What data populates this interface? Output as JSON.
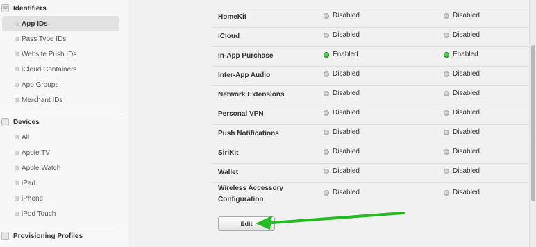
{
  "sidebar": {
    "identifiers": {
      "title": "Identifiers",
      "icon_text": "ID",
      "items": [
        {
          "label": "App IDs",
          "active": true
        },
        {
          "label": "Pass Type IDs",
          "active": false
        },
        {
          "label": "Website Push IDs",
          "active": false
        },
        {
          "label": "iCloud Containers",
          "active": false
        },
        {
          "label": "App Groups",
          "active": false
        },
        {
          "label": "Merchant IDs",
          "active": false
        }
      ]
    },
    "devices": {
      "title": "Devices",
      "items": [
        {
          "label": "All"
        },
        {
          "label": "Apple TV"
        },
        {
          "label": "Apple Watch"
        },
        {
          "label": "iPad"
        },
        {
          "label": "iPhone"
        },
        {
          "label": "iPod Touch"
        }
      ]
    },
    "provisioning": {
      "title": "Provisioning Profiles"
    }
  },
  "services": {
    "rows": [
      {
        "name": "HomeKit",
        "development": "Disabled",
        "distribution": "Disabled"
      },
      {
        "name": "iCloud",
        "development": "Disabled",
        "distribution": "Disabled"
      },
      {
        "name": "In-App Purchase",
        "development": "Enabled",
        "distribution": "Enabled"
      },
      {
        "name": "Inter-App Audio",
        "development": "Disabled",
        "distribution": "Disabled"
      },
      {
        "name": "Network Extensions",
        "development": "Disabled",
        "distribution": "Disabled"
      },
      {
        "name": "Personal VPN",
        "development": "Disabled",
        "distribution": "Disabled"
      },
      {
        "name": "Push Notifications",
        "development": "Disabled",
        "distribution": "Disabled"
      },
      {
        "name": "SiriKit",
        "development": "Disabled",
        "distribution": "Disabled"
      },
      {
        "name": "Wallet",
        "development": "Disabled",
        "distribution": "Disabled"
      },
      {
        "name": "Wireless Accessory Configuration",
        "development": "Disabled",
        "distribution": "Disabled"
      }
    ],
    "enabled_color": "#22a022",
    "disabled_color": "#b0b0b0"
  },
  "actions": {
    "edit_label": "Edit"
  },
  "annotation": {
    "arrow_color": "#22bb22"
  }
}
